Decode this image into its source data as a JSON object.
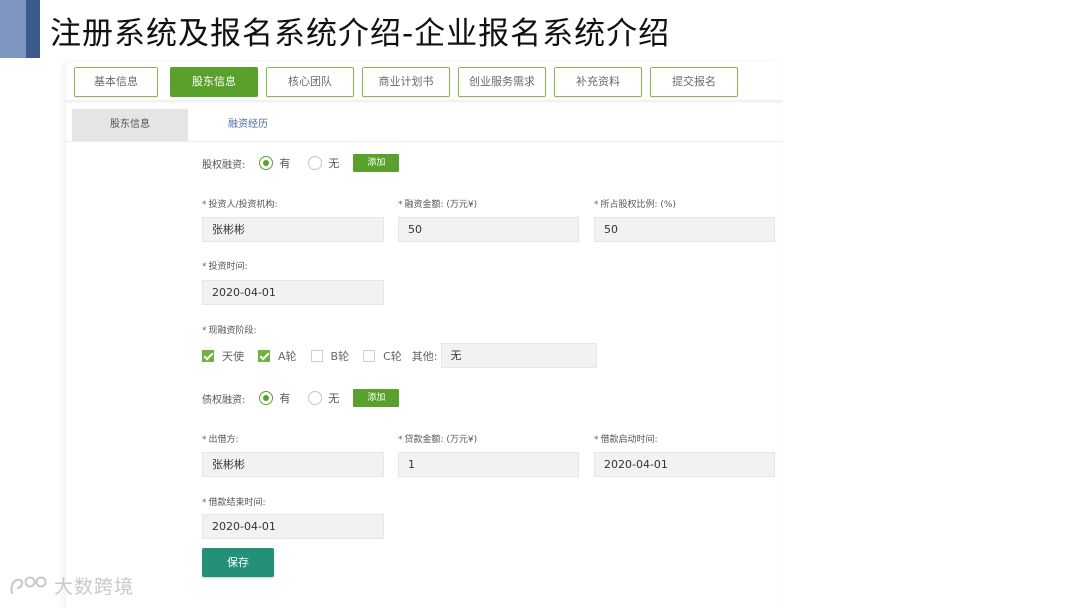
{
  "slide": {
    "title": "注册系统及报名系统介绍-企业报名系统介绍"
  },
  "steps": [
    {
      "label": "基本信息",
      "active": false
    },
    {
      "label": "股东信息",
      "active": true
    },
    {
      "label": "核心团队",
      "active": false
    },
    {
      "label": "商业计划书",
      "active": false
    },
    {
      "label": "创业服务需求",
      "active": false
    },
    {
      "label": "补充资料",
      "active": false
    },
    {
      "label": "提交报名",
      "active": false
    }
  ],
  "subtabs": {
    "shareholder": "股东信息",
    "financing": "融资经历"
  },
  "equity": {
    "label": "股权融资:",
    "yes": "有",
    "no": "无",
    "selected": "有",
    "add": "添加",
    "investor_label": "投资人/投资机构:",
    "investor_value": "张彬彬",
    "amount_label": "融资金额: (万元¥)",
    "amount_value": "50",
    "share_label": "所占股权比例: (%)",
    "share_value": "50",
    "date_label": "投资时间:",
    "date_value": "2020-04-01",
    "stage_label": "现融资阶段:",
    "stages": [
      {
        "label": "天使",
        "checked": true
      },
      {
        "label": "A轮",
        "checked": true
      },
      {
        "label": "B轮",
        "checked": false
      },
      {
        "label": "C轮",
        "checked": false
      }
    ],
    "other_label": "其他:",
    "other_value": "无"
  },
  "debt": {
    "label": "债权融资:",
    "yes": "有",
    "no": "无",
    "selected": "有",
    "add": "添加",
    "lender_label": "出借方:",
    "lender_value": "张彬彬",
    "amount_label": "贷款金额: (万元¥)",
    "amount_value": "1",
    "start_label": "借款启动时间:",
    "start_value": "2020-04-01",
    "end_label": "借款结束时间:",
    "end_value": "2020-04-01"
  },
  "save": "保存",
  "watermark": "大数跨境",
  "colors": {
    "primary_green": "#5aa02c",
    "save_teal": "#24907a",
    "title_bar": "#3c5a8c"
  }
}
